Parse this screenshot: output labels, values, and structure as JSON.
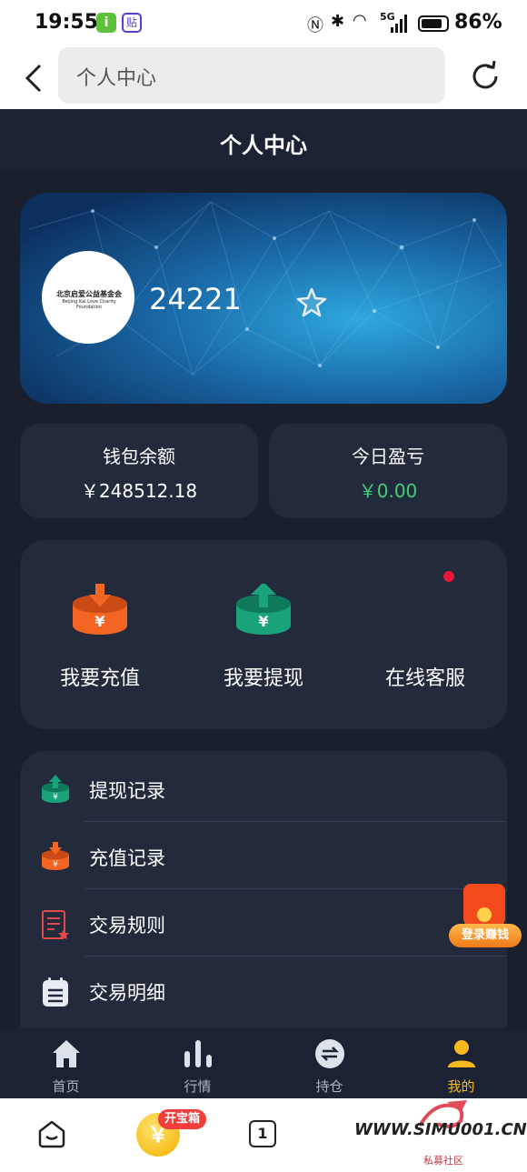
{
  "status_bar": {
    "time": "19:55",
    "app_badge_1": "i",
    "app_badge_2": "贴",
    "signal_text": "5G",
    "battery_pct": "86%",
    "battery_level": 0.86
  },
  "browser": {
    "url_text": "个人中心"
  },
  "header": {
    "title": "个人中心"
  },
  "profile": {
    "avatar_logo_text": "北京启爱公益基金会",
    "avatar_logo_subtext": "Beijing Kai Love Charity Foundation",
    "user_id": "24221"
  },
  "balances": [
    {
      "label": "钱包余额",
      "value": "￥248512.18",
      "color": "#ffffff"
    },
    {
      "label": "今日盈亏",
      "value": "￥0.00",
      "color": "#3ecf7a"
    }
  ],
  "actions": [
    {
      "label": "我要充值",
      "icon": "deposit-icon",
      "color": "#f26522"
    },
    {
      "label": "我要提现",
      "icon": "withdraw-icon",
      "color": "#1aa37a"
    },
    {
      "label": "在线客服",
      "icon": "customer-service-icon"
    }
  ],
  "menu": [
    {
      "label": "提现记录",
      "icon": "withdraw-record-icon"
    },
    {
      "label": "充值记录",
      "icon": "deposit-record-icon"
    },
    {
      "label": "交易规则",
      "icon": "rules-icon"
    },
    {
      "label": "交易明细",
      "icon": "clipboard-icon"
    }
  ],
  "promo": {
    "label": "登录赚钱"
  },
  "tabbar": [
    {
      "label": "首页",
      "icon": "home-icon",
      "active": false
    },
    {
      "label": "行情",
      "icon": "bar-chart-icon",
      "active": false
    },
    {
      "label": "持仓",
      "icon": "swap-icon",
      "active": false
    },
    {
      "label": "我的",
      "icon": "user-icon",
      "active": true
    }
  ],
  "bottom_bar": {
    "coin_glyph": "￥",
    "badge": "开宝箱",
    "tab_count": "1",
    "watermark": "WWW.SIMU001.CN",
    "watermark_sub": "私募社区"
  },
  "colors": {
    "bg": "#1a1f2e",
    "card": "#232a3c",
    "accent_gold": "#f6b91d",
    "profit_green": "#3ecf7a"
  }
}
